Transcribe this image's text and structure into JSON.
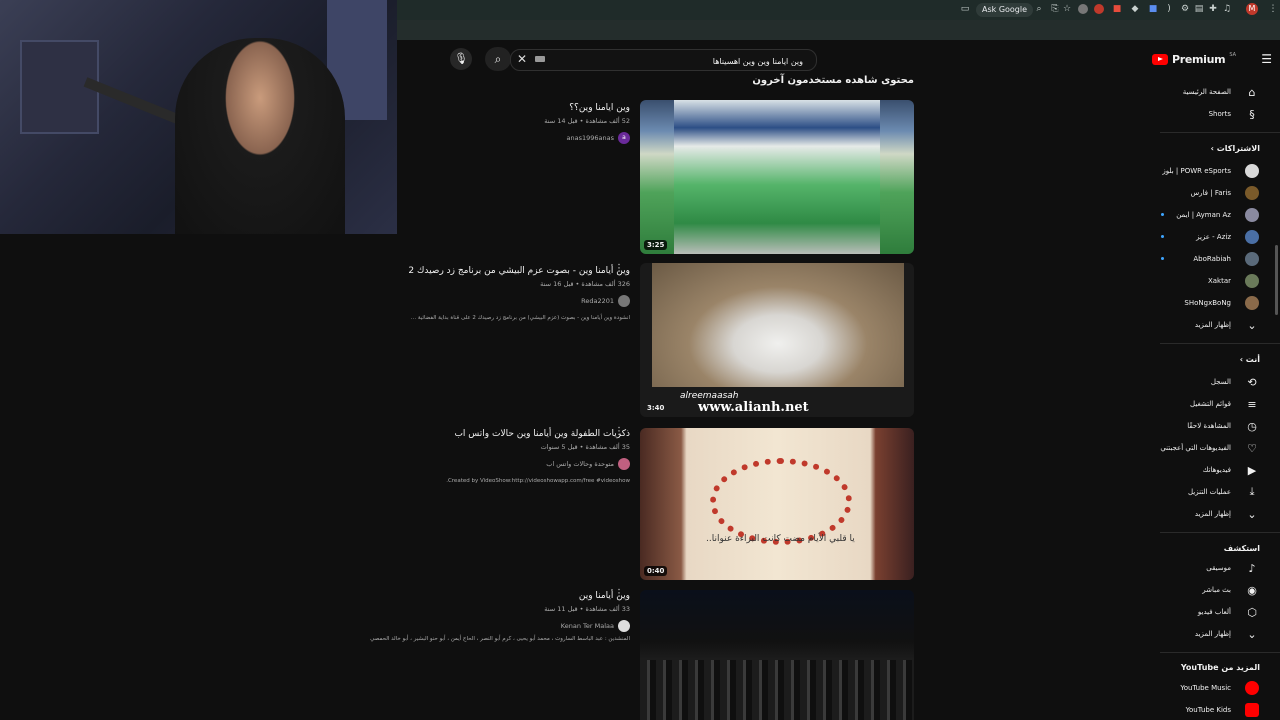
{
  "browser": {
    "ask_google": "Ask Google",
    "profile_initial": "M"
  },
  "search": {
    "query": "وين ايامنا وين وين اهسيناها",
    "search_icon": "search-icon",
    "mic_icon": "mic-icon",
    "clear_icon": "close-icon"
  },
  "section_title": "محتوى شاهده مستخدمون آخرون",
  "results": [
    {
      "title": "وين ايامنا وين؟؟",
      "meta": "52 ألف مشاهدة • قبل 14 سنة",
      "channel": "anas1996anas",
      "avatar_letter": "a",
      "description": "",
      "duration": "3:25"
    },
    {
      "title": "وين أيامنا وين - بصوت عزم البيشي من برنامج زد رصيدك 2",
      "meta": "326 ألف مشاهدة • قبل 16 سنة",
      "channel": "Reda2201",
      "avatar_letter": "",
      "description": "انشودة وين أيامنا وين - بصوت (عزم البيشي) من برنامج زد رصيدك 2 على قناة بداية الفضائية ...",
      "duration": "3:40",
      "watermark": "www.alianh.net",
      "watermark2": "alreemaasah"
    },
    {
      "title": "ذكريات الطفولة وين أيامنا وين حالات واتس اب",
      "meta": "35 ألف مشاهدة • قبل 5 سنوات",
      "channel": "متوحدة وحالات واتس اب",
      "avatar_letter": "",
      "description": "Created by VideoShow:http://videoshowapp.com/free #videoshow.",
      "duration": "0:40",
      "caption": "يا قلبي الأيام مضت كانت البراءة عنوانا.."
    },
    {
      "title": "وين أيامنا وين",
      "meta": "33 ألف مشاهدة • قبل 11 سنة",
      "channel": "Kenan Ter Malaa",
      "avatar_letter": "",
      "description": "المنشدين : عبد الباسط الساروت ، محمد أبو يحيى ، كرم أبو النصر ، الحاج أيمن ، أبو حنو البشير ، أبو خالد الحمصي",
      "duration": ""
    }
  ],
  "sidebar": {
    "logo_text": "Premium",
    "logo_region": "SA",
    "home": "الصفحة الرئيسية",
    "shorts": "Shorts",
    "subscriptions_head": "الاشتراكات",
    "subscriptions": [
      {
        "name": "POWR eSports | بلوز",
        "color": "#d9d9d9",
        "live": false
      },
      {
        "name": "Faris | فارس",
        "color": "#7a5a2a",
        "live": false
      },
      {
        "name": "Ayman Az | ايمن",
        "color": "#8a8aa0",
        "live": true
      },
      {
        "name": "Aziz - عزيز",
        "color": "#4a6fa5",
        "live": true
      },
      {
        "name": "AboRabiah",
        "color": "#5a6a7a",
        "live": true
      },
      {
        "name": "Xaktar",
        "color": "#6a7a5a",
        "live": false
      },
      {
        "name": "SHoNgxBoNg",
        "color": "#8a6a4a",
        "live": false
      }
    ],
    "show_more": "إظهار المزيد",
    "you_head": "أنت",
    "you_items": [
      {
        "label": "السجل",
        "icon": "history-icon",
        "glyph": "⟲"
      },
      {
        "label": "قوائم التشغيل",
        "icon": "playlists-icon",
        "glyph": "≡"
      },
      {
        "label": "المشاهدة لاحقًا",
        "icon": "clock-icon",
        "glyph": "◷"
      },
      {
        "label": "الفيديوهات التي أعجبتني",
        "icon": "thumbs-up-icon",
        "glyph": "👍"
      },
      {
        "label": "فيديوهاتك",
        "icon": "your-videos-icon",
        "glyph": "▶"
      },
      {
        "label": "عمليات التنزيل",
        "icon": "download-icon",
        "glyph": "⤓"
      }
    ],
    "explore_head": "استكشف",
    "explore_items": [
      {
        "label": "موسيقى",
        "icon": "music-icon",
        "glyph": "♪"
      },
      {
        "label": "بث مباشر",
        "icon": "live-icon",
        "glyph": "◉"
      },
      {
        "label": "ألعاب فيديو",
        "icon": "gaming-icon",
        "glyph": "⬡"
      }
    ],
    "more_from_head": "المزيد من YouTube",
    "more_from_items": [
      {
        "label": "YouTube Music",
        "color": "#ff0000"
      },
      {
        "label": "YouTube Kids",
        "color": "#ff0000"
      }
    ]
  }
}
